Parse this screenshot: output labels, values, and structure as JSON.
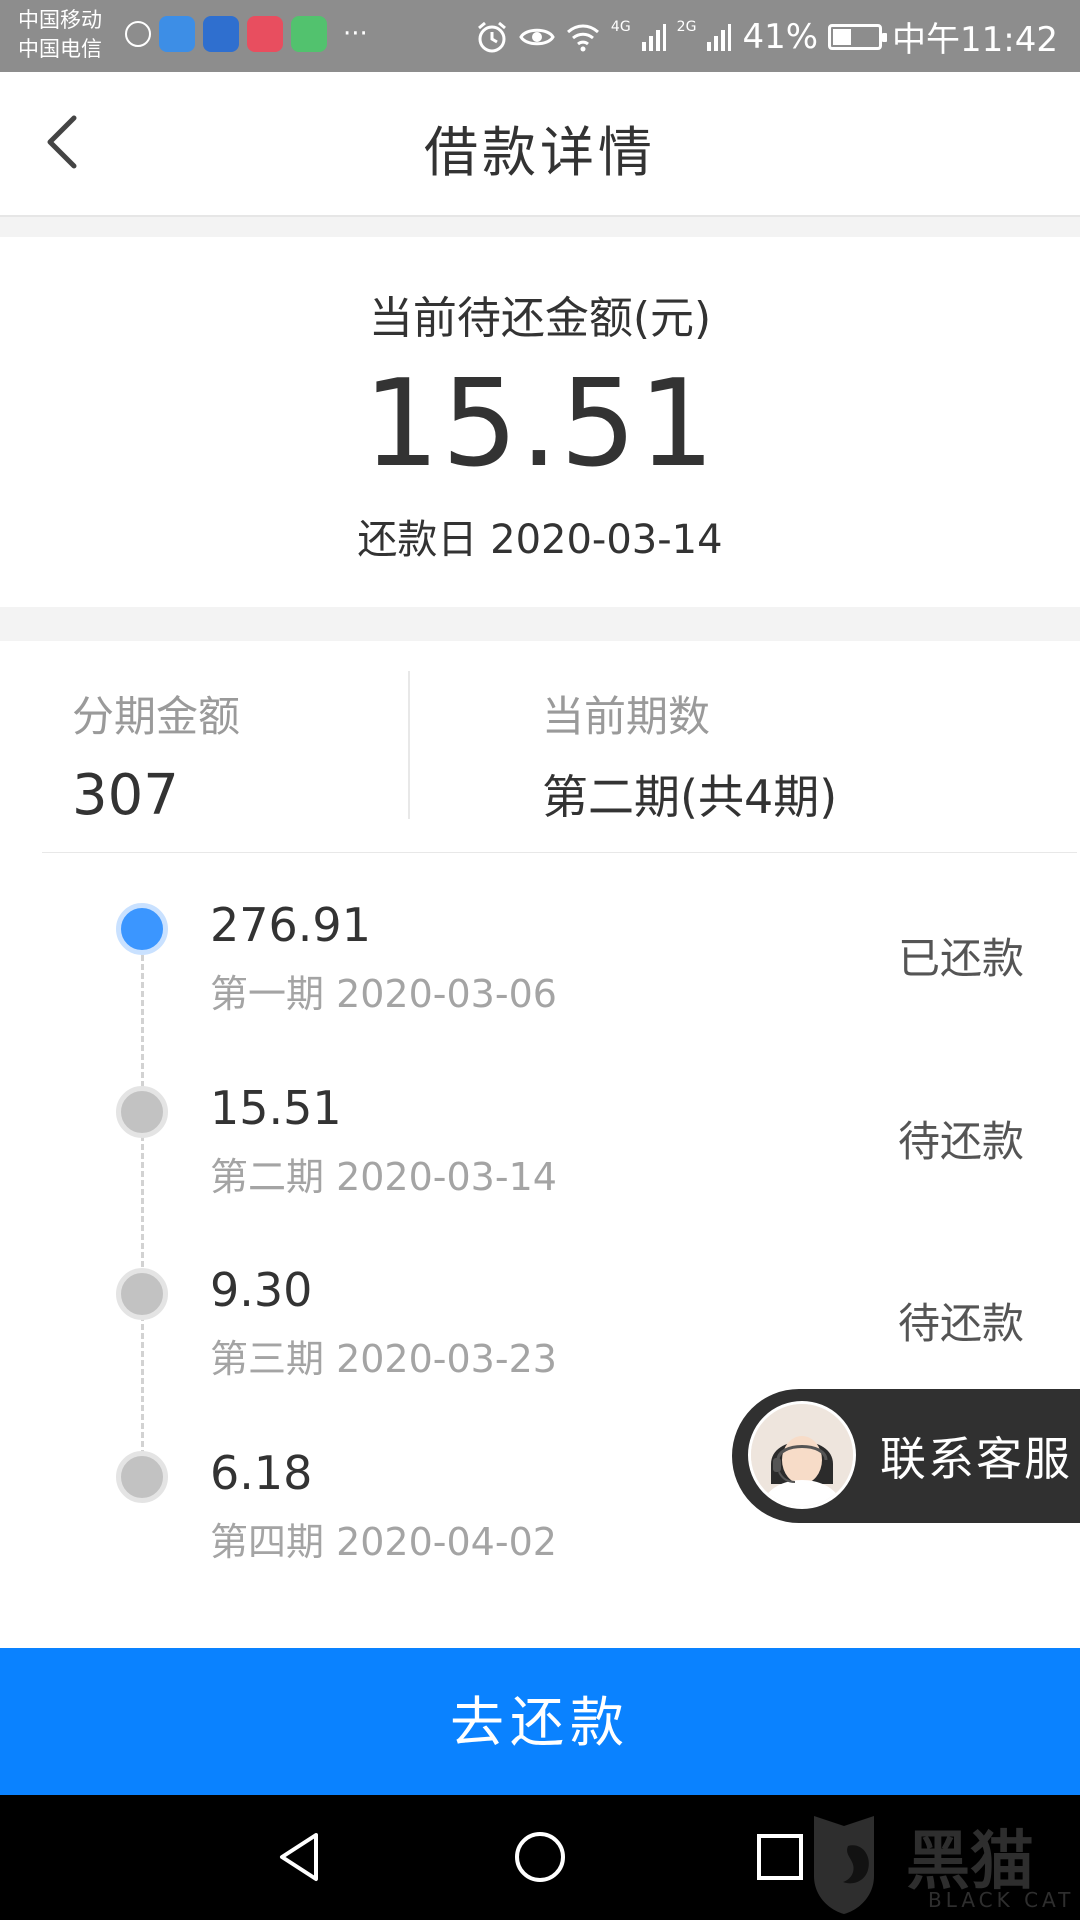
{
  "status_bar": {
    "carrier_1": "中国移动",
    "carrier_2": "中国电信",
    "signal_4g": "4G",
    "signal_2g": "2G",
    "battery_text": "41%",
    "battery_level": 0.41,
    "time": "中午11:42",
    "app_icons": [
      "weather-icon",
      "bird-app-icon",
      "bank-app-icon",
      "video-app-icon",
      "play-app-icon"
    ],
    "overflow": "···"
  },
  "header": {
    "title": "借款详情"
  },
  "summary": {
    "label": "当前待还金额(元)",
    "amount": "15.51",
    "due_date": "还款日 2020-03-14"
  },
  "info": {
    "installment_label": "分期金额",
    "installment_value": "307",
    "period_label": "当前期数",
    "period_value": "第二期(共4期)"
  },
  "schedule": [
    {
      "amount": "276.91",
      "detail": "第一期 2020-03-06",
      "status": "已还款",
      "state": "paid"
    },
    {
      "amount": "15.51",
      "detail": "第二期 2020-03-14",
      "status": "待还款",
      "state": "pending"
    },
    {
      "amount": "9.30",
      "detail": "第三期 2020-03-23",
      "status": "待还款",
      "state": "pending"
    },
    {
      "amount": "6.18",
      "detail": "第四期 2020-04-02",
      "status": "",
      "state": "pending"
    }
  ],
  "customer_service": {
    "label": "联系客服"
  },
  "footer": {
    "pay_button": "去还款"
  },
  "watermark": {
    "text": "黑猫",
    "sub": "BLACK CAT"
  },
  "colors": {
    "accent": "#0a82ff",
    "paid_dot": "#3b96ff",
    "pending_dot": "#c2c2c2"
  }
}
